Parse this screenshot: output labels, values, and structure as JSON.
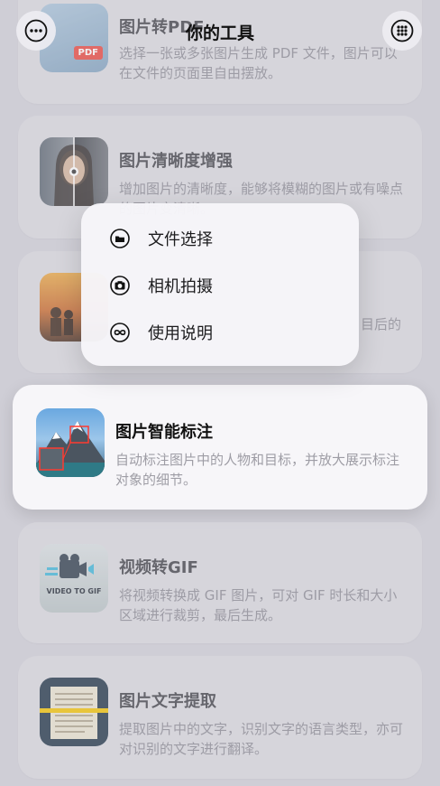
{
  "header": {
    "title": "你的工具",
    "more_icon": "ellipsis-circle-icon",
    "grid_icon": "grid-dots-icon"
  },
  "tools": [
    {
      "title": "图片转PDF",
      "desc": "选择一张或多张图片生成 PDF 文件，图片可以在文件的页面里自由摆放。"
    },
    {
      "title": "图片清晰度增强",
      "desc": "增加图片的清晰度，能够将模糊的图片或有噪点的图片变清晰。"
    },
    {
      "title": "",
      "desc": "目后的"
    },
    {
      "title": "图片智能标注",
      "desc": "自动标注图片中的人物和目标，并放大展示标注对象的细节。"
    },
    {
      "title": "视频转GIF",
      "desc": "将视频转换成 GIF 图片，可对 GIF 时长和大小区域进行裁剪，最后生成。"
    },
    {
      "title": "图片文字提取",
      "desc": "提取图片中的文字，识别文字的语言类型，亦可对识别的文字进行翻译。"
    }
  ],
  "thumb_text": {
    "pdf_badge": "PDF",
    "video_gif_badge": "VIDEO TO GIF"
  },
  "menu": {
    "items": [
      {
        "label": "文件选择",
        "icon": "folder-icon"
      },
      {
        "label": "相机拍摄",
        "icon": "camera-icon"
      },
      {
        "label": "使用说明",
        "icon": "infinity-icon"
      }
    ]
  }
}
